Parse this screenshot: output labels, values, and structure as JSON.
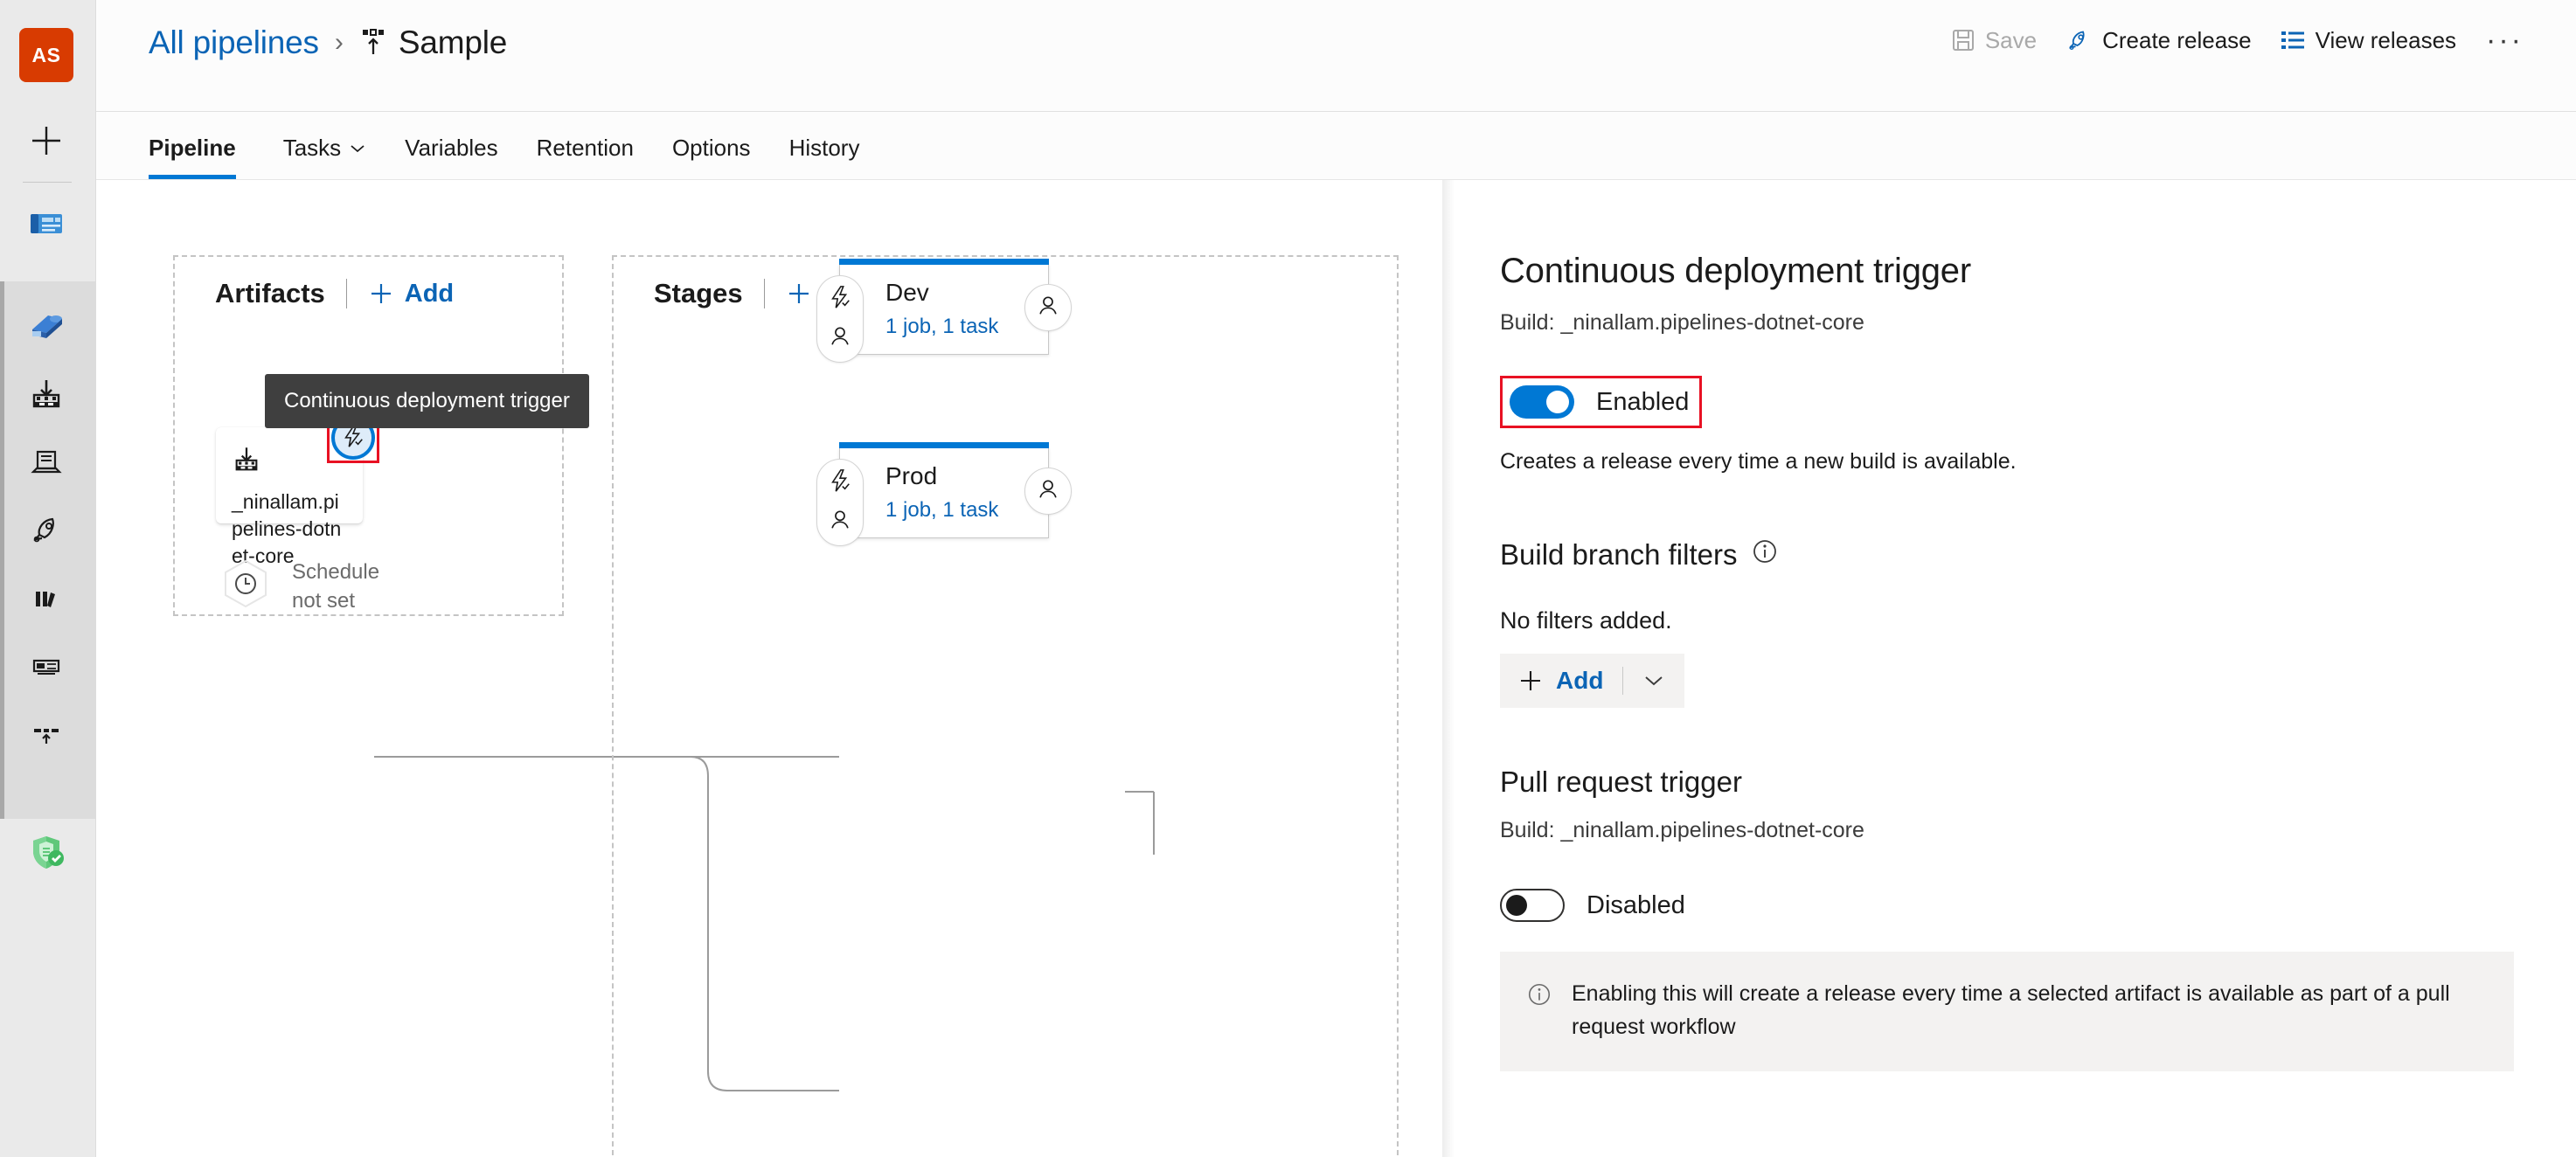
{
  "rail": {
    "avatar_initials": "AS",
    "items": [
      {
        "name": "new-item",
        "icon": "plus-icon"
      },
      {
        "name": "boards",
        "icon": "boards-icon"
      },
      {
        "name": "pipelines",
        "icon": "pipelines-icon"
      },
      {
        "name": "artifacts-download",
        "icon": "download-box-icon"
      },
      {
        "name": "releases",
        "icon": "release-icon"
      },
      {
        "name": "deploy",
        "icon": "rocket-icon"
      },
      {
        "name": "library",
        "icon": "library-icon"
      },
      {
        "name": "task-groups",
        "icon": "task-group-icon"
      },
      {
        "name": "deployment-groups",
        "icon": "deployment-group-icon"
      },
      {
        "name": "security",
        "icon": "shield-check-icon"
      }
    ]
  },
  "breadcrumb": {
    "root_label": "All pipelines",
    "separator": "›",
    "current_label": "Sample"
  },
  "toolbar": {
    "save_label": "Save",
    "create_release_label": "Create release",
    "view_releases_label": "View releases",
    "more_label": "···"
  },
  "tabs": [
    {
      "label": "Pipeline",
      "active": true,
      "has_chevron": false
    },
    {
      "label": "Tasks",
      "active": false,
      "has_chevron": true
    },
    {
      "label": "Variables",
      "active": false,
      "has_chevron": false
    },
    {
      "label": "Retention",
      "active": false,
      "has_chevron": false
    },
    {
      "label": "Options",
      "active": false,
      "has_chevron": false
    },
    {
      "label": "History",
      "active": false,
      "has_chevron": false
    }
  ],
  "canvas": {
    "artifacts": {
      "title": "Artifacts",
      "add_label": "Add",
      "card_name": "_ninallam.pipelines-dotnet-core",
      "schedule_label": "Schedule\nnot set",
      "schedule_line1": "Schedule",
      "schedule_line2": "not set",
      "cd_trigger_tooltip": "Continuous deployment trigger"
    },
    "stages": {
      "title": "Stages",
      "add_label": "Add",
      "items": [
        {
          "name": "Dev",
          "meta": "1 job, 1 task"
        },
        {
          "name": "Prod",
          "meta": "1 job, 1 task"
        }
      ]
    }
  },
  "panel": {
    "title": "Continuous deployment trigger",
    "subtitle": "Build: _ninallam.pipelines-dotnet-core",
    "toggle_label": "Enabled",
    "toggle_state": "on",
    "note": "Creates a release every time a new build is available.",
    "branch_filters": {
      "title": "Build branch filters",
      "empty_text": "No filters added.",
      "add_label": "Add"
    },
    "pull_request": {
      "title": "Pull request trigger",
      "subtitle": "Build: _ninallam.pipelines-dotnet-core",
      "toggle_label": "Disabled",
      "toggle_state": "off",
      "info_text": "Enabling this will create a release every time a selected artifact is available as part of a pull request workflow"
    }
  },
  "colors": {
    "accent": "#0078d4",
    "link": "#0b64b5",
    "highlight": "#e81123",
    "avatar": "#d83b01",
    "tooltip_bg": "#3f3f3f",
    "panel_surface": "#f3f2f1"
  }
}
